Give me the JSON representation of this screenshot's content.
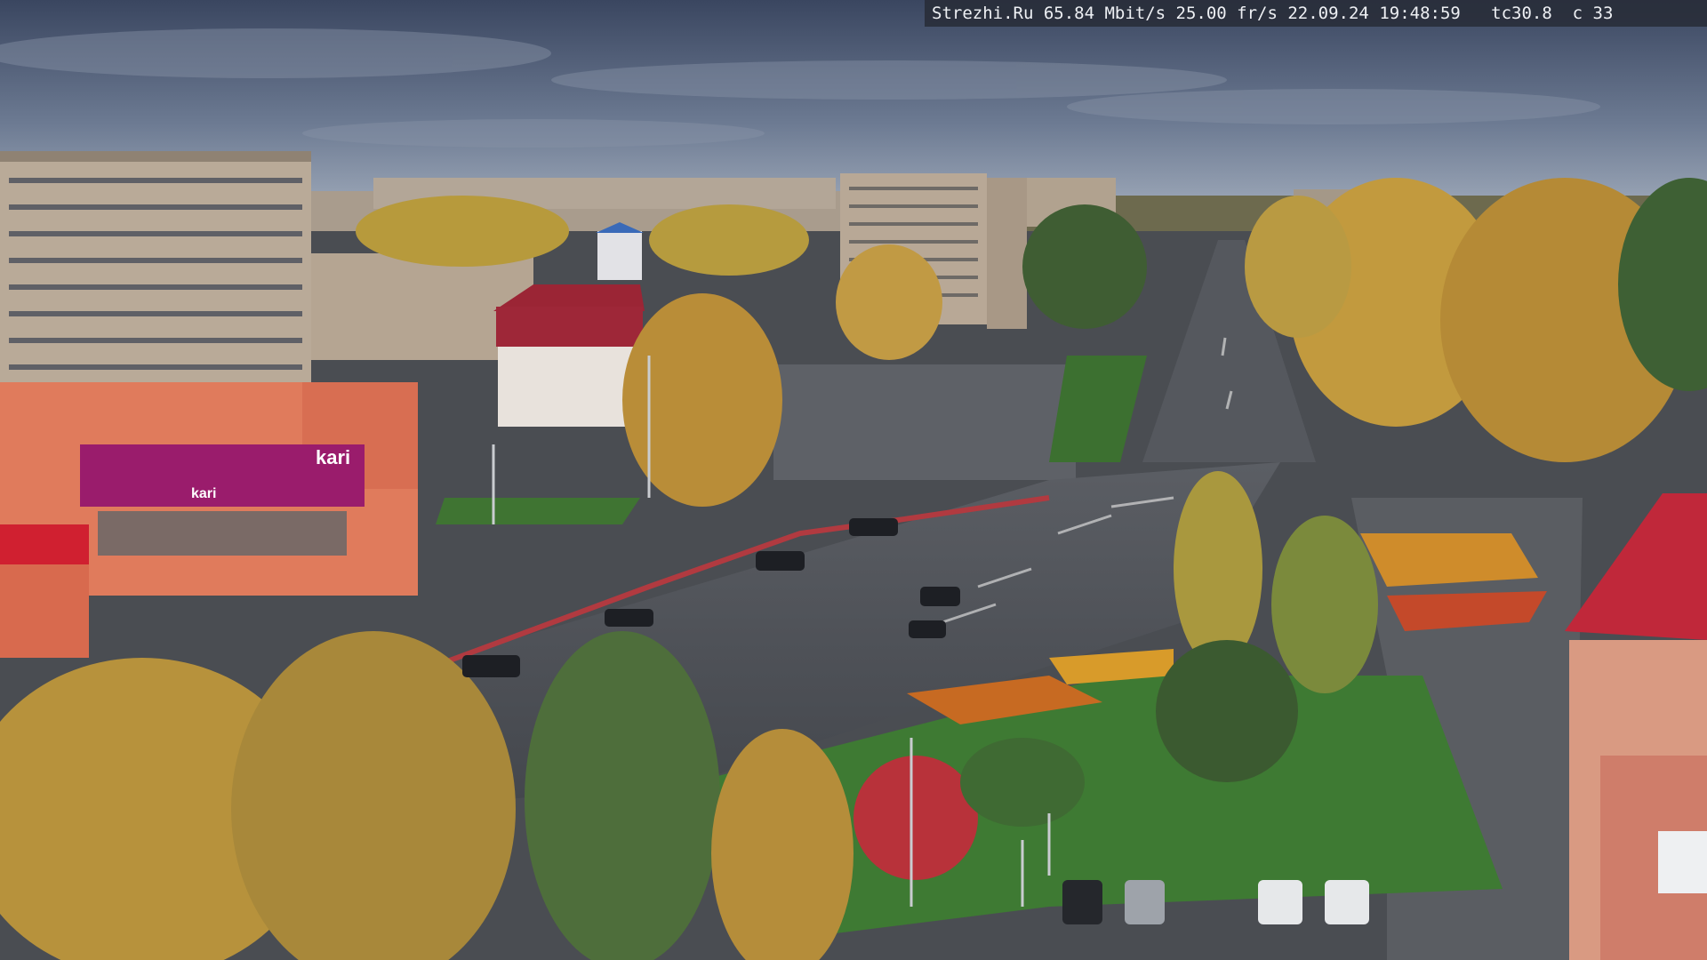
{
  "overlay": {
    "osd_text": "Strezhi.Ru 65.84 Mbit/s 25.00 fr/s 22.09.24 19:48:59   tc30.8  c 33"
  },
  "signs": {
    "store_main": "kari",
    "store_small": "kari"
  },
  "colors": {
    "sky_top": "#3c4861",
    "sky_bottom": "#8f9bad",
    "asphalt": "#4c4f55",
    "grass": "#3f7a34",
    "autumn_yellow": "#c9a040",
    "kari_magenta": "#9a1c6c",
    "building_beige": "#b9a997",
    "red_roof": "#c0283a"
  }
}
